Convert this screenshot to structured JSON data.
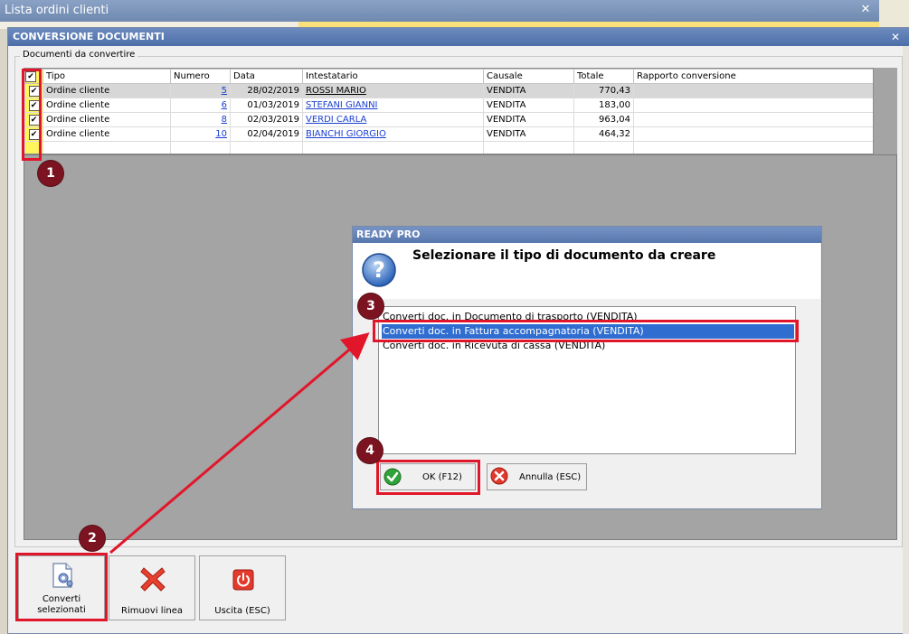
{
  "background_window": {
    "title": "Lista ordini clienti",
    "close": "✕"
  },
  "main_window": {
    "title": "CONVERSIONE DOCUMENTI",
    "close": "✕",
    "group_label": "Documenti da convertire",
    "grid": {
      "columns": [
        "Tipo",
        "Numero",
        "Data",
        "Intestatario",
        "Causale",
        "Totale",
        "Rapporto conversione"
      ],
      "rows": [
        {
          "checked": true,
          "tipo": "Ordine cliente",
          "numero": "5",
          "data": "28/02/2019",
          "intestatario": "ROSSI MARIO",
          "causale": "VENDITA",
          "totale": "770,43",
          "rapporto": ""
        },
        {
          "checked": true,
          "tipo": "Ordine cliente",
          "numero": "6",
          "data": "01/03/2019",
          "intestatario": "STEFANI GIANNI",
          "causale": "VENDITA",
          "totale": "183,00",
          "rapporto": ""
        },
        {
          "checked": true,
          "tipo": "Ordine cliente",
          "numero": "8",
          "data": "02/03/2019",
          "intestatario": "VERDI CARLA",
          "causale": "VENDITA",
          "totale": "963,04",
          "rapporto": ""
        },
        {
          "checked": true,
          "tipo": "Ordine cliente",
          "numero": "10",
          "data": "02/04/2019",
          "intestatario": "BIANCHI GIORGIO",
          "causale": "VENDITA",
          "totale": "464,32",
          "rapporto": ""
        }
      ]
    },
    "toolbar": {
      "convert_label_line1": "Converti",
      "convert_label_line2": "selezionati",
      "remove_label": "Rimuovi linea",
      "exit_label": "Uscita (ESC)"
    }
  },
  "dialog": {
    "title": "READY PRO",
    "heading": "Selezionare il tipo di documento da creare",
    "options": [
      "Converti doc. in Documento di trasporto (VENDITA)",
      "Converti doc. in Fattura accompagnatoria (VENDITA)",
      "Converti doc. in Ricevuta di cassa (VENDITA)"
    ],
    "selected_option": 1,
    "ok_label": "OK (F12)",
    "cancel_label": "Annulla (ESC)"
  },
  "annotations": {
    "markers": [
      "1",
      "2",
      "3",
      "4"
    ],
    "color": "#e2162a"
  },
  "colors": {
    "marker_fill": "#7b1420",
    "selection": "#2f6ed0",
    "checkbox_column": "#fff55c"
  }
}
